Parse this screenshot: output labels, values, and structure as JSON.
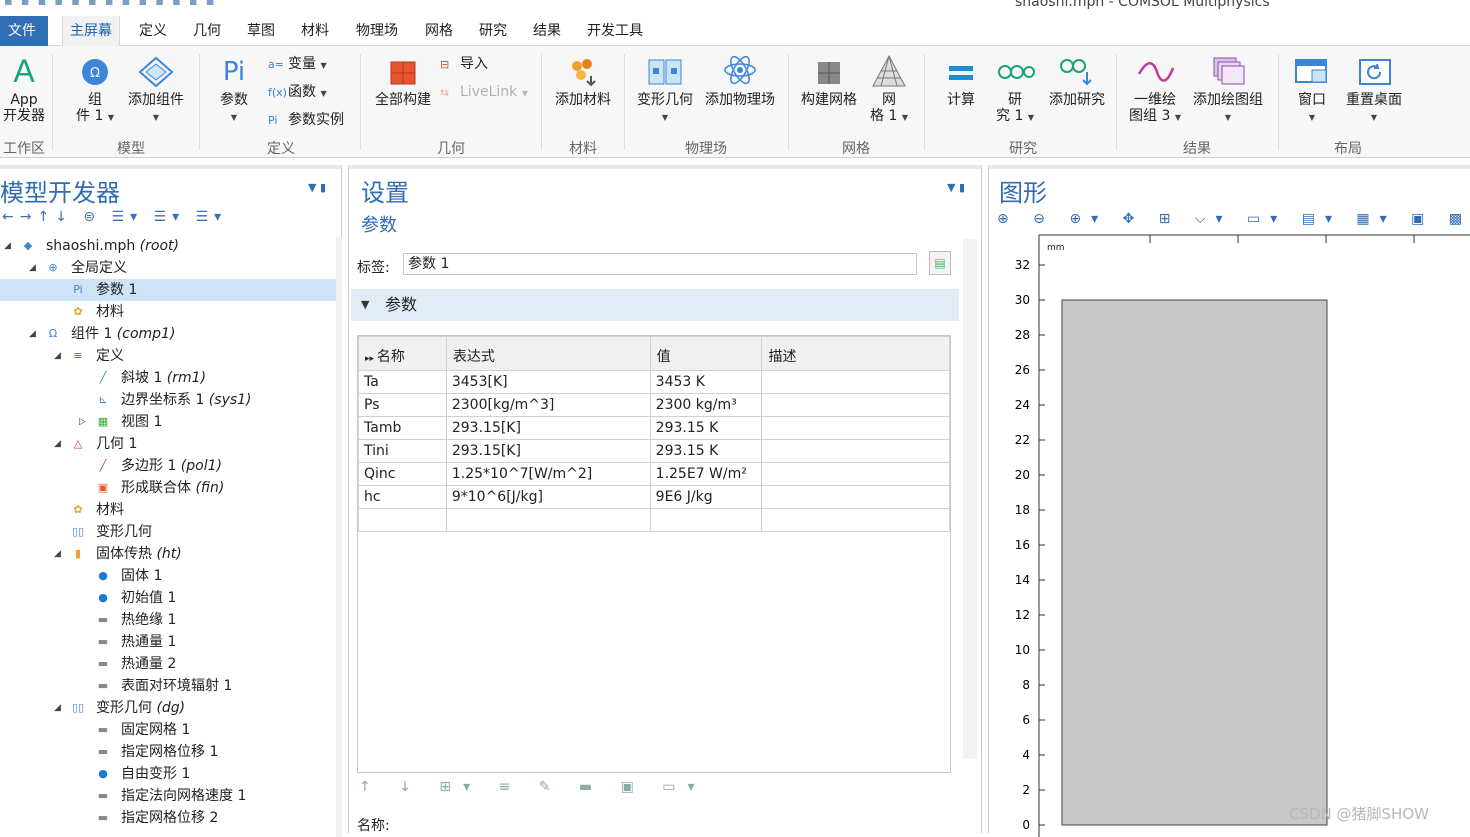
{
  "window": {
    "title": "shaoshi.mph - COMSOL Multiphysics"
  },
  "menu": {
    "file": "文件",
    "tabs": [
      "主屏幕",
      "定义",
      "几何",
      "草图",
      "材料",
      "物理场",
      "网格",
      "研究",
      "结果",
      "开发工具"
    ]
  },
  "ribbon": {
    "app_line1": "App",
    "app_line2": "开发器",
    "g_workspace": "工作区",
    "component_line1": "组",
    "component_line2": "件 1",
    "add_component": "添加组件",
    "g_model": "模型",
    "parameters": "参数",
    "variables": "变量",
    "functions": "函数",
    "param_case": "参数实例",
    "g_definitions": "定义",
    "build_all": "全部构建",
    "import": "导入",
    "livelink": "LiveLink",
    "g_geometry": "几何",
    "add_material": "添加材料",
    "g_materials": "材料",
    "deformed_geom": "变形几何",
    "add_physics": "添加物理场",
    "g_physics": "物理场",
    "build_mesh": "构建网格",
    "mesh_line1": "网",
    "mesh_line2": "格 1",
    "g_mesh": "网格",
    "compute": "计算",
    "study_line1": "研",
    "study_line2": "究 1",
    "add_study": "添加研究",
    "g_study": "研究",
    "plot1d_line1": "一维绘",
    "plot1d_line2": "图组 3",
    "add_plot": "添加绘图组",
    "g_results": "结果",
    "window": "窗口",
    "reset_desktop": "重置桌面",
    "g_layout": "布局"
  },
  "model_builder": {
    "title": "模型开发器",
    "tree": [
      {
        "label": "shaoshi.mph",
        "tag": "(root)"
      },
      {
        "label": "全局定义",
        "tag": ""
      },
      {
        "label": "参数 1",
        "tag": ""
      },
      {
        "label": "材料",
        "tag": ""
      },
      {
        "label": "组件 1",
        "tag": "(comp1)"
      },
      {
        "label": "定义",
        "tag": ""
      },
      {
        "label": "斜坡 1",
        "tag": "(rm1)"
      },
      {
        "label": "边界坐标系 1",
        "tag": "(sys1)"
      },
      {
        "label": "视图 1",
        "tag": ""
      },
      {
        "label": "几何 1",
        "tag": ""
      },
      {
        "label": "多边形 1",
        "tag": "(pol1)"
      },
      {
        "label": "形成联合体",
        "tag": "(fin)"
      },
      {
        "label": "材料",
        "tag": ""
      },
      {
        "label": "变形几何",
        "tag": ""
      },
      {
        "label": "固体传热",
        "tag": "(ht)"
      },
      {
        "label": "固体 1",
        "tag": ""
      },
      {
        "label": "初始值 1",
        "tag": ""
      },
      {
        "label": "热绝缘 1",
        "tag": ""
      },
      {
        "label": "热通量 1",
        "tag": ""
      },
      {
        "label": "热通量 2",
        "tag": ""
      },
      {
        "label": "表面对环境辐射 1",
        "tag": ""
      },
      {
        "label": "变形几何",
        "tag": "(dg)"
      },
      {
        "label": "固定网格 1",
        "tag": ""
      },
      {
        "label": "指定网格位移 1",
        "tag": ""
      },
      {
        "label": "自由变形 1",
        "tag": ""
      },
      {
        "label": "指定法向网格速度 1",
        "tag": ""
      },
      {
        "label": "指定网格位移 2",
        "tag": ""
      }
    ]
  },
  "settings": {
    "title": "设置",
    "subtitle": "参数",
    "label_caption": "标签:",
    "label_value": "参数 1",
    "section": "参数",
    "columns": [
      "名称",
      "表达式",
      "值",
      "描述"
    ],
    "rows": [
      [
        "Ta",
        "3453[K]",
        "3453 K",
        ""
      ],
      [
        "Ps",
        "2300[kg/m^3]",
        "2300 kg/m³",
        ""
      ],
      [
        "Tamb",
        "293.15[K]",
        "293.15 K",
        ""
      ],
      [
        "Tini",
        "293.15[K]",
        "293.15 K",
        ""
      ],
      [
        "Qinc",
        "1.25*10^7[W/m^2]",
        "1.25E7 W/m²",
        ""
      ],
      [
        "hc",
        "9*10^6[J/kg]",
        "9E6 J/kg",
        ""
      ],
      [
        "",
        "",
        "",
        ""
      ]
    ],
    "name_caption": "名称:"
  },
  "graphics": {
    "title": "图形",
    "unit": "mm",
    "y_ticks": [
      "32",
      "30",
      "28",
      "26",
      "24",
      "22",
      "20",
      "18",
      "16",
      "14",
      "12",
      "10",
      "8",
      "6",
      "4",
      "2",
      "0"
    ],
    "rect_fill": "#c8c8c8",
    "watermark": "CSDN @猪脚SHOW"
  },
  "colors": {
    "accent": "#2f6db5",
    "selection": "#cfe3f7"
  }
}
